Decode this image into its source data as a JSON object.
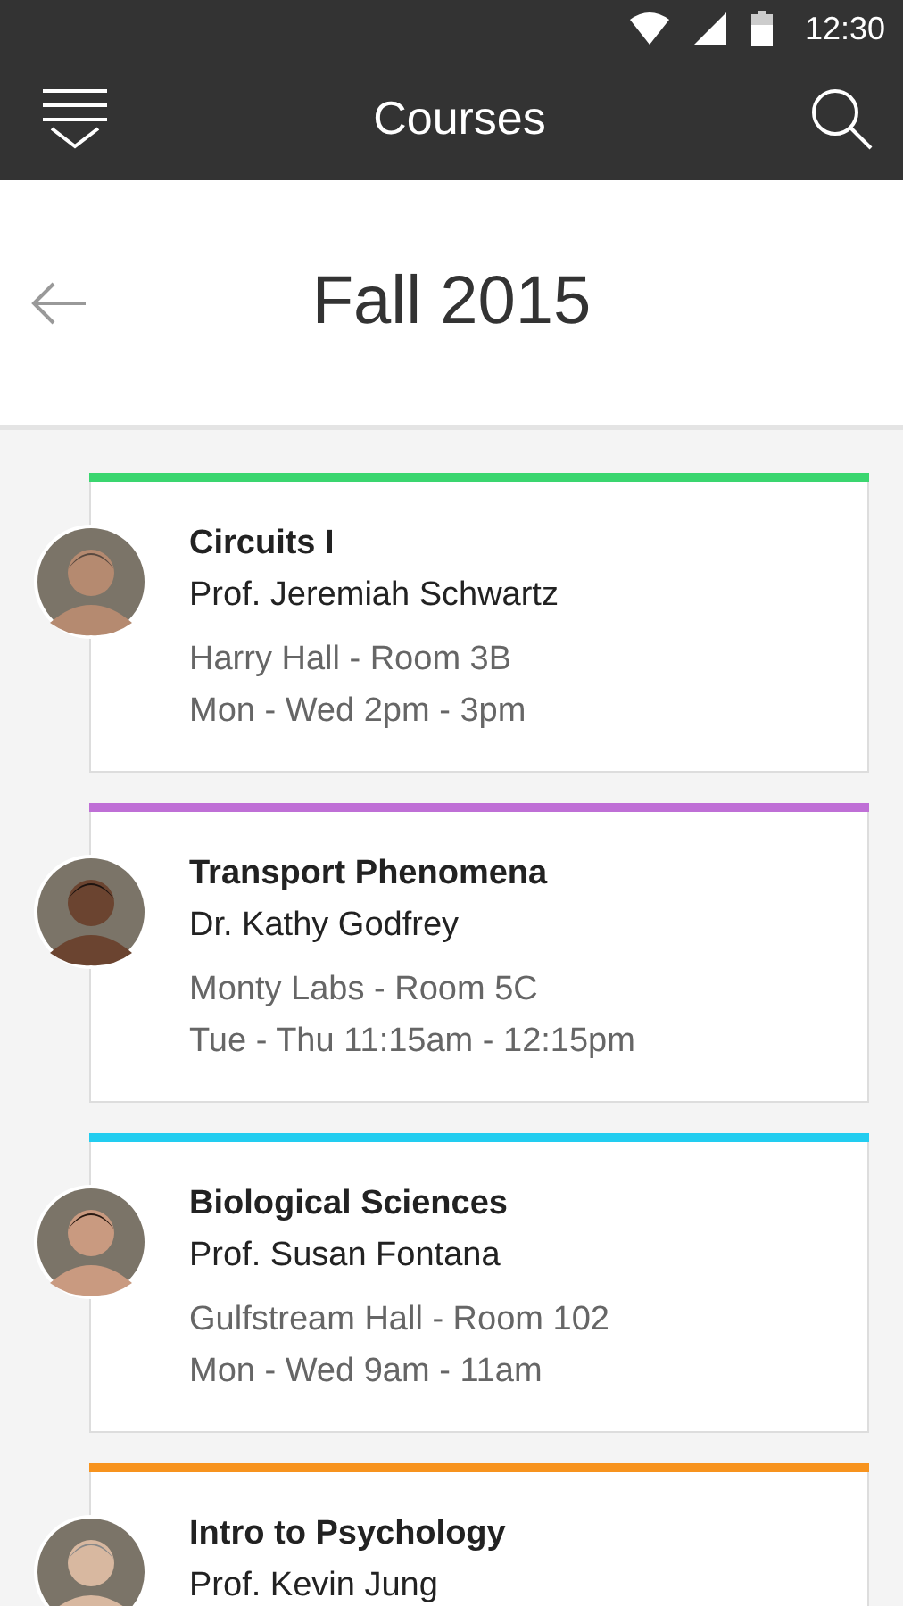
{
  "status_bar": {
    "time": "12:30"
  },
  "app_bar": {
    "title": "Courses"
  },
  "header": {
    "title": "Fall 2015"
  },
  "courses": [
    {
      "title": "Circuits I",
      "instructor": "Prof. Jeremiah Schwartz",
      "location": "Harry Hall - Room 3B",
      "schedule": "Mon - Wed 2pm - 3pm",
      "color": "#3ad66f"
    },
    {
      "title": "Transport Phenomena",
      "instructor": "Dr. Kathy Godfrey",
      "location": "Monty Labs - Room 5C",
      "schedule": "Tue - Thu 11:15am - 12:15pm",
      "color": "#bf6fd6"
    },
    {
      "title": "Biological Sciences",
      "instructor": "Prof. Susan Fontana",
      "location": "Gulfstream Hall - Room 102",
      "schedule": "Mon - Wed 9am - 11am",
      "color": "#22cdf0"
    },
    {
      "title": "Intro to Psychology",
      "instructor": "Prof. Kevin Jung",
      "color": "#f7931e"
    }
  ]
}
